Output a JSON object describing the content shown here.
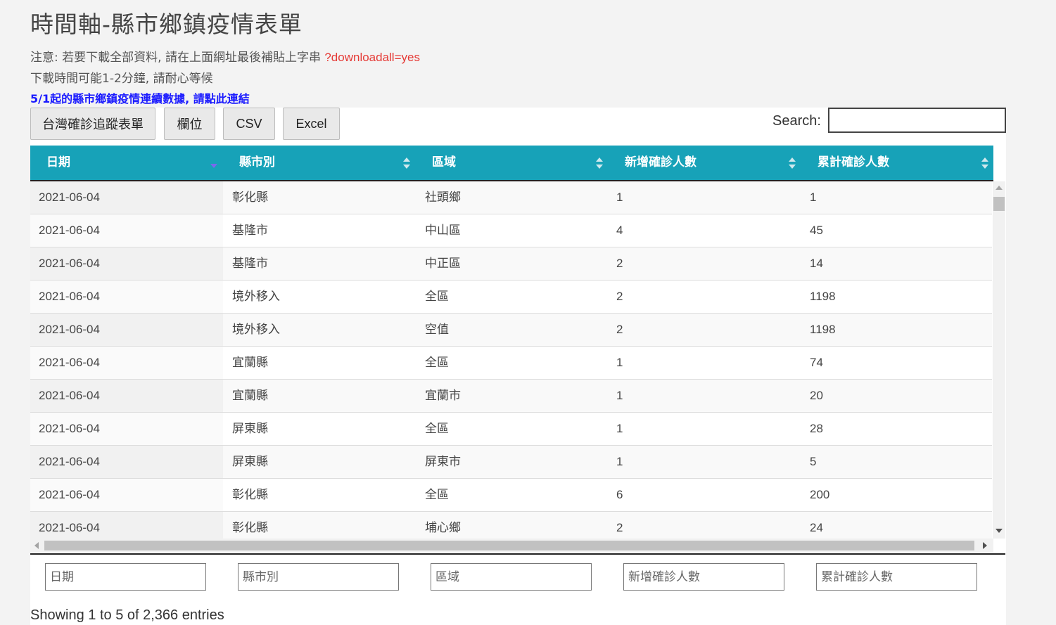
{
  "page": {
    "title": "時間軸-縣市鄉鎮疫情表單",
    "note_prefix": "注意: 若要下載全部資料, 請在上面網址最後補貼上字串 ",
    "note_param": "?downloadall=yes",
    "note2": "下載時間可能1-2分鐘, 請耐心等候",
    "link": "5/1起的縣市鄉鎮疫情連續數據, 請點此連結"
  },
  "toolbar": {
    "buttons": [
      "台灣確診追蹤表單",
      "欄位",
      "CSV",
      "Excel"
    ],
    "search_label": "Search:"
  },
  "colors": {
    "header": "#17a2b8",
    "note_param": "#e53935",
    "link": "#1a1aff"
  },
  "table": {
    "columns": [
      "日期",
      "縣市別",
      "區域",
      "新增確診人數",
      "累計確診人數"
    ],
    "sorted_column": "日期",
    "rows": [
      [
        "2021-06-04",
        "彰化縣",
        "社頭鄉",
        "1",
        "1"
      ],
      [
        "2021-06-04",
        "基隆市",
        "中山區",
        "4",
        "45"
      ],
      [
        "2021-06-04",
        "基隆市",
        "中正區",
        "2",
        "14"
      ],
      [
        "2021-06-04",
        "境外移入",
        "全區",
        "2",
        "1198"
      ],
      [
        "2021-06-04",
        "境外移入",
        "空值",
        "2",
        "1198"
      ],
      [
        "2021-06-04",
        "宜蘭縣",
        "全區",
        "1",
        "74"
      ],
      [
        "2021-06-04",
        "宜蘭縣",
        "宜蘭市",
        "1",
        "20"
      ],
      [
        "2021-06-04",
        "屏東縣",
        "全區",
        "1",
        "28"
      ],
      [
        "2021-06-04",
        "屏東縣",
        "屏東市",
        "1",
        "5"
      ],
      [
        "2021-06-04",
        "彰化縣",
        "全區",
        "6",
        "200"
      ],
      [
        "2021-06-04",
        "彰化縣",
        "埔心鄉",
        "2",
        "24"
      ]
    ],
    "filters": [
      "日期",
      "縣市別",
      "區域",
      "新增確診人數",
      "累計確診人數"
    ],
    "info": "Showing 1 to 5 of 2,366 entries"
  }
}
